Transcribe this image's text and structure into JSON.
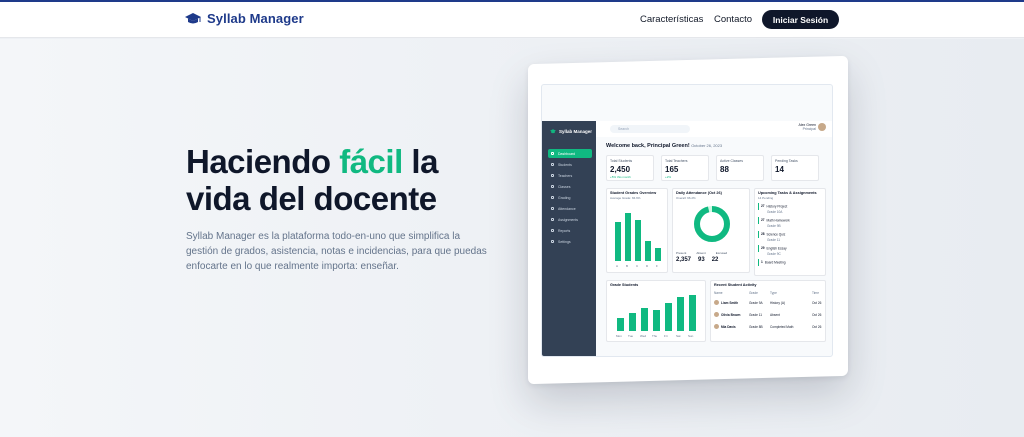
{
  "nav": {
    "brand": "Syllab Manager",
    "links": [
      "Características",
      "Contacto"
    ],
    "login_label": "Iniciar Sesión"
  },
  "hero": {
    "headline_part1": "Haciendo ",
    "headline_accent": "fácil",
    "headline_part2": " la",
    "headline_line2": "vida del docente",
    "subtext": "Syllab Manager es la plataforma todo-en-uno que simplifica la gestión de grados, asistencia, notas e incidencias, para que puedas enfocarte en lo que realmente importa: enseñar."
  },
  "colors": {
    "brand": "#1e3a8a",
    "accent": "#10b981",
    "dark": "#0f172a"
  },
  "dashboard": {
    "app_name": "Syllab Manager",
    "search_placeholder": "Search",
    "user_name": "Alex Green",
    "user_role": "Principal",
    "welcome": "Welcome back, Principal Green!",
    "date": "October 26, 2023",
    "sidebar": [
      "Dashboard",
      "Students",
      "Teachers",
      "Classes",
      "Grading",
      "Attendance",
      "Assignments",
      "Reports",
      "Settings"
    ],
    "stats": [
      {
        "label": "Total Students",
        "value": "2,450",
        "sub": "+5% this month"
      },
      {
        "label": "Total Teachers",
        "value": "165",
        "sub": "+2%"
      },
      {
        "label": "Active Classes",
        "value": "88",
        "sub": ""
      },
      {
        "label": "Pending Tasks",
        "value": "14",
        "sub": ""
      }
    ],
    "grades_overview": {
      "title": "Student Grades Overview",
      "sub": "Average Grade: 84.6%",
      "labels": [
        "A",
        "B",
        "C",
        "D",
        "F"
      ],
      "values": [
        67,
        82,
        70,
        34,
        22
      ]
    },
    "attendance": {
      "title": "Daily Attendance (Oct 26)",
      "sub": "Overall: 96.2%",
      "present_label": "Present",
      "absent_label": "Absent",
      "excused_label": "Excused",
      "present": "2,357",
      "absent": "93",
      "excused": "22",
      "rate": 0.962
    },
    "tasks": {
      "title": "Upcoming Tasks & Assignments",
      "sub": "14 Pending",
      "items": [
        {
          "day": "27",
          "title": "History Project",
          "grade": "Grade 10A"
        },
        {
          "day": "27",
          "title": "Math Homework",
          "grade": "Grade 9B"
        },
        {
          "day": "28",
          "title": "Science Quiz",
          "grade": "Grade 11"
        },
        {
          "day": "29",
          "title": "English Essay",
          "grade": "Grade 9C"
        },
        {
          "day": "1",
          "title": "Board Meeting",
          "grade": ""
        }
      ]
    },
    "grade_students": {
      "title": "Grade Students",
      "labels": [
        "Mon",
        "Tue",
        "Wed",
        "Thu",
        "Fri",
        "Sat",
        "Sun"
      ],
      "values": [
        35,
        48,
        60,
        55,
        75,
        90,
        95
      ]
    },
    "activity": {
      "title": "Recent Student Activity",
      "headers": [
        "Name",
        "Grade",
        "Type",
        "Time"
      ],
      "rows": [
        {
          "name": "Liam Smith",
          "grade": "Grade 9A",
          "type": "History (A)",
          "time": "Oct 26"
        },
        {
          "name": "Olivia Brown",
          "grade": "Grade 11",
          "type": "Absent",
          "time": "Oct 26"
        },
        {
          "name": "Mia Davis",
          "grade": "Grade 8B",
          "type": "Completed Math",
          "time": "Oct 26"
        }
      ]
    }
  }
}
